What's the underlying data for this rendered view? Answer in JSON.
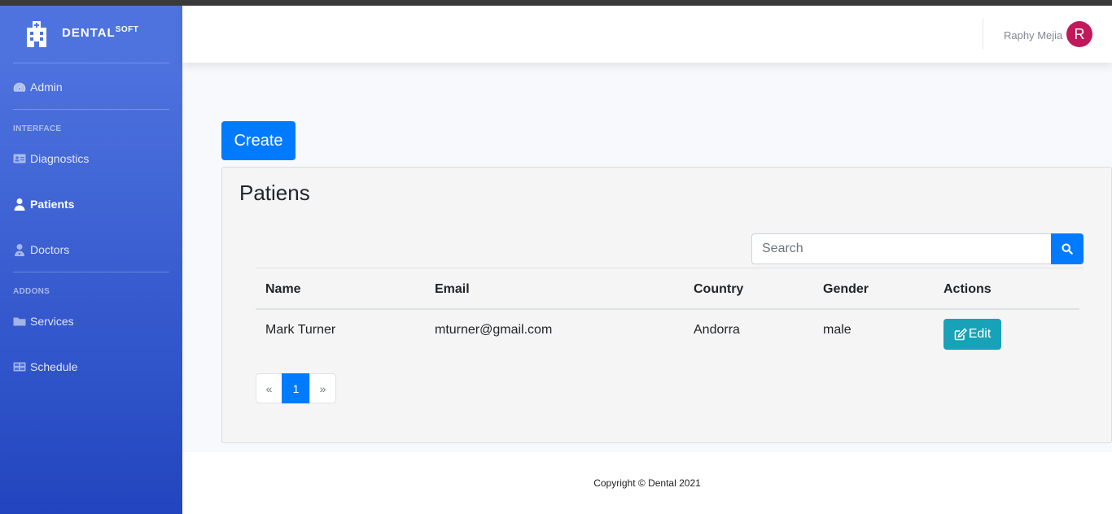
{
  "brand": {
    "name": "DENTAL",
    "suffix": "SOFT"
  },
  "sidebar": {
    "items": [
      {
        "label": "Admin",
        "icon": "dashboard-icon"
      },
      {
        "label": "Diagnostics",
        "icon": "id-card-icon"
      },
      {
        "label": "Patients",
        "icon": "user-icon",
        "active": true
      },
      {
        "label": "Doctors",
        "icon": "user-doctor-icon"
      },
      {
        "label": "Services",
        "icon": "folder-icon"
      },
      {
        "label": "Schedule",
        "icon": "table-icon"
      }
    ],
    "headings": [
      "INTERFACE",
      "ADDONS"
    ]
  },
  "topbar": {
    "username": "Raphy Mejia",
    "avatar_letter": "R",
    "avatar_color": "#c2185b"
  },
  "actions": {
    "create_label": "Create"
  },
  "card": {
    "title": "Patiens",
    "search_placeholder": "Search",
    "columns": [
      "Name",
      "Email",
      "Country",
      "Gender",
      "Actions"
    ],
    "rows": [
      {
        "name": "Mark Turner",
        "email": "mturner@gmail.com",
        "country": "Andorra",
        "gender": "male",
        "action": "Edit"
      }
    ],
    "pagination": {
      "prev": "«",
      "current": "1",
      "next": "»"
    }
  },
  "footer": {
    "copyright": "Copyright © Dental 2021"
  },
  "colors": {
    "primary": "#007bff",
    "info": "#17a2b8",
    "sidebar_top": "#4e73df",
    "sidebar_bottom": "#2245bf"
  }
}
